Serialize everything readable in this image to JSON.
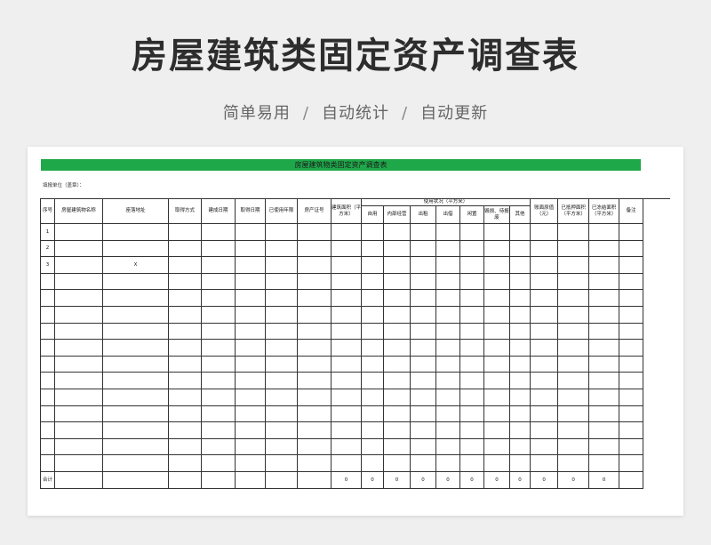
{
  "header": {
    "title": "房屋建筑类固定资产调查表",
    "tags": [
      "简单易用",
      "自动统计",
      "自动更新"
    ],
    "separator": "/"
  },
  "sheet": {
    "banner_title": "房屋建筑物类固定资产调查表",
    "unit_label": "填报单位（盖章）：",
    "accent_color": "#1fa84a",
    "columns": {
      "seq": "序号",
      "name": "房屋建筑物名称",
      "address": "座落地址",
      "acquire_method": "取得方式",
      "build_date": "建成日期",
      "acquire_date": "取得日期",
      "years_used": "已使用年限",
      "cert_no": "房产证号",
      "area": "建筑面积（平方米）",
      "usage_group": "使用状况（平方米）",
      "usage": [
        "自用",
        "内部经营",
        "出租",
        "出借",
        "闲置",
        "毁损、待报废",
        "其他"
      ],
      "book_value": "账面原值（元）",
      "secured_area": "已抵押面积（平方米）",
      "sealed_area": "已冻结面积（平方米）",
      "remark": "备注"
    },
    "rows": [
      {
        "seq": "1",
        "address": ""
      },
      {
        "seq": "2",
        "address": ""
      },
      {
        "seq": "3",
        "address": "X"
      },
      {
        "seq": "",
        "address": ""
      },
      {
        "seq": "",
        "address": ""
      },
      {
        "seq": "",
        "address": ""
      },
      {
        "seq": "",
        "address": ""
      },
      {
        "seq": "",
        "address": ""
      },
      {
        "seq": "",
        "address": ""
      },
      {
        "seq": "",
        "address": ""
      },
      {
        "seq": "",
        "address": ""
      },
      {
        "seq": "",
        "address": ""
      },
      {
        "seq": "",
        "address": ""
      },
      {
        "seq": "",
        "address": ""
      },
      {
        "seq": "",
        "address": ""
      }
    ],
    "total": {
      "label": "合计",
      "values": [
        "0",
        "0",
        "0",
        "0",
        "0",
        "0",
        "0",
        "0",
        "0",
        "0",
        "0"
      ]
    }
  }
}
